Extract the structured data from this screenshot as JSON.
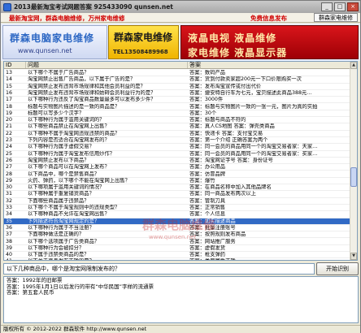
{
  "window": {
    "title": "2013最新淘宝考试网题答案 925433090 qunsen.net",
    "controls": [
      "_",
      "□",
      "×"
    ]
  },
  "toolbar": {
    "link_left": "最新淘宝网，群森电脑维修，万州家电维修",
    "link_right": "免费信息发布",
    "button": "群森家电维修"
  },
  "banner": {
    "b1_title": "群森电脑家电维修",
    "b1_url": "www.qunsen.net",
    "b2_title": "群森家电维修",
    "b2_tel": "TEL13508489968",
    "b3_line1": "液晶电视  液晶维修",
    "b3_line2": "家电维修  液晶显示器"
  },
  "grid": {
    "columns": [
      "ID",
      "问题",
      "答案"
    ],
    "rows": [
      {
        "id": "13",
        "q": "以下哪个不属于广告商品？",
        "a": "答案：数码产品"
      },
      {
        "id": "14",
        "q": "淘宝网禁止出售广告商品，以下属于广告的是？",
        "a": "答案：货到付款卖家超200元一下口价限购买一次"
      },
      {
        "id": "15",
        "q": "淘宝网禁止发布违背市场规律和其他会员利益的是？",
        "a": "答案：发布淘宝宣传或付出代价"
      },
      {
        "id": "16",
        "q": "淘宝网禁止发布违背市场规律和妨碍会员利益行为的是？",
        "a": "答案：捷安特自行车为七元，宝贝描述此商品388元…"
      },
      {
        "id": "17",
        "q": "以下哪种行为违反了淘宝商品数量最多可以发布多少件？",
        "a": "答案：3000件"
      },
      {
        "id": "18",
        "q": "标题与实物图片描述的是一致的商品是？",
        "a": "答案：标题与实物图片一致的一张一元，图片为真的实拍"
      },
      {
        "id": "19",
        "q": "标题可以写多少个汉字？",
        "a": "答案：30个"
      },
      {
        "id": "20",
        "q": "以下哪种行为属于滥用关键词的？",
        "a": "答案：标题与商品不符的"
      },
      {
        "id": "21",
        "q": "以下哪些商品禁止在淘宝网上出售？",
        "a": "答案：真人CS地图  答案：弹壳类商品"
      },
      {
        "id": "22",
        "q": "以下哪种不属于淘宝网违规违禁的商品？",
        "a": "答案：快递卡  答案：支付宝交易"
      },
      {
        "id": "23",
        "q": "下列内容是否适合在淘宝网发布的？",
        "a": "答案：第一个介绍  正确答案为两个"
      },
      {
        "id": "24",
        "q": "以下哪种行为属于虚假交易？",
        "a": "答案：同一会员的商品用同一个的淘宝交易者家：天家…"
      },
      {
        "id": "25",
        "q": "以下哪种行为属于淘宝发布信用炒作？",
        "a": "答案：同一会员的商品用同一个的淘宝交易者家：买家…"
      },
      {
        "id": "26",
        "q": "淘宝网禁止发布以下商品？",
        "a": "答案：淘宝网证字号  答案：身份证号"
      },
      {
        "id": "27",
        "q": "以下哪个商品可以在淘宝网上发布？",
        "a": "答案：办公用品"
      },
      {
        "id": "28",
        "q": "以下商品中，哪个是禁售商品？",
        "a": "答案：仿冒品牌"
      },
      {
        "id": "29",
        "q": "火药、弹药，以下哪个不能在淘宝网上出售？",
        "a": "答案：爆竹"
      },
      {
        "id": "30",
        "q": "以下哪项属于滥用关键词的情况？",
        "a": "答案：在商品名称中加入其他品牌名"
      },
      {
        "id": "31",
        "q": "以下哪种属于重复铺货商品？",
        "a": "答案：同一商品发布两次以上"
      },
      {
        "id": "32",
        "q": "下面哪些商品属于违禁品？",
        "a": "答案：管制刀具"
      },
      {
        "id": "33",
        "q": "以下哪个不属于淘宝规则中的违规类型？",
        "a": "答案：正常销售"
      },
      {
        "id": "34",
        "q": "以下哪种商品不允许在淘宝网出售？",
        "a": "答案：个人信息"
      },
      {
        "id": "35",
        "q": "下列描述符合淘宝网规定的是？",
        "a": "答案：如实描述商品"
      },
      {
        "id": "36",
        "q": "以下哪种行为属于不当注册？",
        "a": "答案：批量注册账号"
      },
      {
        "id": "37",
        "q": "下面哪种做法是正确的？",
        "a": "答案：按照规则发布商品"
      },
      {
        "id": "38",
        "q": "以下哪个选项属于广告类商品？",
        "a": "答案：网站推广服务"
      },
      {
        "id": "39",
        "q": "以下哪种行为会被扣分？",
        "a": "答案：虚假发货"
      },
      {
        "id": "40",
        "q": "以下属于违禁类商品的是？",
        "a": "答案：枪支弹药"
      },
      {
        "id": "41",
        "q": "以下关于商品发布正确的是？",
        "a": "答案：类目属性正确"
      }
    ]
  },
  "watermark": {
    "line1": "群森电脑维修",
    "line2": "www.qunsen.net"
  },
  "search": {
    "query": "以下几种商品中，哪个是淘宝网限制发布的？",
    "button": "开始识别"
  },
  "answers": [
    "答案：1992年的旧邮票",
    "答案：1995年1月1日以后发行的带有“中华民国”字样的流通票",
    "答案：第五套人民币"
  ],
  "status": "版权所有 © 2012-2022  群森软件  http://www.qunsen.net"
}
